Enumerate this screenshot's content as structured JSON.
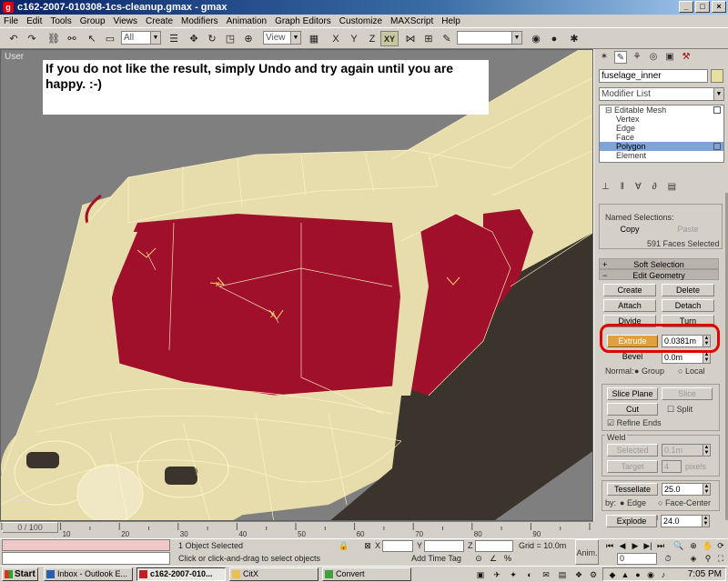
{
  "window": {
    "title": "c162-2007-010308-1cs-cleanup.gmax - gmax",
    "controls": [
      "_",
      "□",
      "×"
    ]
  },
  "menu": [
    "File",
    "Edit",
    "Tools",
    "Group",
    "Views",
    "Create",
    "Modifiers",
    "Animation",
    "Graph Editors",
    "Customize",
    "MAXScript",
    "Help"
  ],
  "toolbar": {
    "selection_filter": "All",
    "ref_coord": "View",
    "axis_xy": "XY",
    "named_set": ""
  },
  "viewport": {
    "label": "User",
    "callout": "If you do not like the result, simply Undo and try again until you are happy. :-)"
  },
  "command_panel": {
    "object_name": "fuselage_inner",
    "modifier_list": "Modifier List",
    "stack": [
      {
        "label": "Editable Mesh",
        "type": "root",
        "selected": false
      },
      {
        "label": "Vertex",
        "type": "sub",
        "selected": false
      },
      {
        "label": "Edge",
        "type": "sub",
        "selected": false
      },
      {
        "label": "Face",
        "type": "sub",
        "selected": false
      },
      {
        "label": "Polygon",
        "type": "sub",
        "selected": true
      },
      {
        "label": "Element",
        "type": "sub",
        "selected": false
      }
    ],
    "named_selections": {
      "label": "Named Selections:",
      "copy": "Copy",
      "paste": "Paste",
      "count": "591 Faces Selected"
    },
    "rollouts": {
      "soft_selection": "Soft Selection",
      "edit_geometry": "Edit Geometry"
    },
    "edit_geometry": {
      "create": "Create",
      "delete": "Delete",
      "attach": "Attach",
      "detach": "Detach",
      "divide": "Divide",
      "turn": "Turn",
      "extrude": "Extrude",
      "extrude_value": "0.0381m",
      "bevel": "Bevel",
      "bevel_value": "0.0m",
      "normal_label": "Normal:",
      "normal_group": "Group",
      "normal_local": "Local",
      "slice_plane": "Slice Plane",
      "slice": "Slice",
      "cut": "Cut",
      "split": "Split",
      "refine_ends": "Refine Ends",
      "weld_label": "Weld",
      "selected": "Selected",
      "selected_value": "0.1m",
      "target": "Target",
      "target_value": "4",
      "pixels": "pixels",
      "tessellate": "Tessellate",
      "tessellate_value": "25.0",
      "by_label": "by:",
      "by_edge": "Edge",
      "by_face_center": "Face-Center",
      "explode": "Explode",
      "explode_value": "24.0"
    }
  },
  "timeline": {
    "frame": "0 / 100",
    "ticks": [
      "10",
      "20",
      "30",
      "40",
      "50",
      "60",
      "70",
      "80",
      "90"
    ]
  },
  "status": {
    "selection": "1 Object Selected",
    "prompt": "Click or click-and-drag to select objects",
    "x_label": "X",
    "y_label": "Y",
    "z_label": "Z",
    "grid": "Grid = 10.0m",
    "add_time_tag": "Add Time Tag",
    "anim": "Anim.",
    "frame_field": "0"
  },
  "taskbar": {
    "start": "Start",
    "tasks": [
      "Inbox - Outlook E...",
      "c162-2007-010...",
      "CitX",
      "Convert"
    ],
    "active_task": 1,
    "clock": "7:05 PM"
  },
  "colors": {
    "viewport_bg": "#7f7f7f",
    "mesh_tan": "#e6dcac",
    "mesh_red": "#a0102a",
    "selected_stack": "#7ea5d6",
    "extrude_active": "#e0a040",
    "highlight_circle": "#e00000"
  }
}
